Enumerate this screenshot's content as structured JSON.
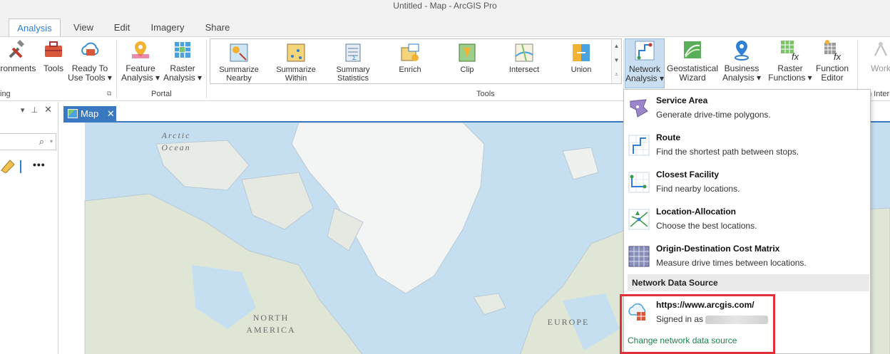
{
  "window": {
    "title": "Untitled - Map - ArcGIS Pro"
  },
  "tabs": [
    "Analysis",
    "View",
    "Edit",
    "Imagery",
    "Share"
  ],
  "ribbon": {
    "geoprocessing": {
      "environments": "ironments",
      "tools": "Tools",
      "ready_line1": "Ready To",
      "ready_line2": "Use Tools ▾",
      "group_label": "ing"
    },
    "portal": {
      "feature_line1": "Feature",
      "feature_line2": "Analysis ▾",
      "raster_line1": "Raster",
      "raster_line2": "Analysis ▾",
      "group_label": "Portal"
    },
    "tools_gallery": {
      "items": [
        {
          "line1": "Summarize",
          "line2": "Nearby",
          "icon": "summarize-nearby-icon"
        },
        {
          "line1": "Summarize",
          "line2": "Within",
          "icon": "summarize-within-icon"
        },
        {
          "line1": "Summary",
          "line2": "Statistics",
          "icon": "summary-statistics-icon"
        },
        {
          "line1": "Enrich",
          "line2": "",
          "icon": "enrich-icon"
        },
        {
          "line1": "Clip",
          "line2": "",
          "icon": "clip-icon"
        },
        {
          "line1": "Intersect",
          "line2": "",
          "icon": "intersect-icon"
        },
        {
          "line1": "Union",
          "line2": "",
          "icon": "union-icon"
        }
      ],
      "group_label": "Tools"
    },
    "workflows": [
      {
        "line1": "Network",
        "line2": "Analysis ▾",
        "icon": "network-analysis-icon"
      },
      {
        "line1": "Geostatistical",
        "line2": "Wizard",
        "icon": "geostatistical-wizard-icon"
      },
      {
        "line1": "Business",
        "line2": "Analysis ▾",
        "icon": "business-analysis-icon"
      },
      {
        "line1": "Raster",
        "line2": "Functions ▾",
        "icon": "raster-functions-icon"
      },
      {
        "line1": "Function",
        "line2": "Editor",
        "icon": "function-editor-icon"
      },
      {
        "line1": "Work",
        "line2": "",
        "icon": "workflow-icon"
      }
    ],
    "right_group_label": "n Inter"
  },
  "left_pane": {
    "more": "•••"
  },
  "map": {
    "tab_label": "Map",
    "labels": {
      "arctic_line1": "Arctic",
      "arctic_line2": "Ocean",
      "na_line1": "NORTH",
      "na_line2": "AMERICA",
      "europe": "EUROPE"
    }
  },
  "network_menu": {
    "items": [
      {
        "title": "Service Area",
        "desc": "Generate drive-time polygons."
      },
      {
        "title": "Route",
        "desc": "Find the shortest path between stops."
      },
      {
        "title": "Closest Facility",
        "desc": "Find nearby locations."
      },
      {
        "title": "Location-Allocation",
        "desc": "Choose the best locations."
      },
      {
        "title": "Origin-Destination Cost Matrix",
        "desc": "Measure drive times between locations."
      }
    ],
    "data_source_header": "Network Data Source",
    "source_url": "https://www.arcgis.com/",
    "signed_in_label": "Signed in as",
    "change_link": "Change network data source"
  },
  "colors": {
    "accent": "#2f7fd2",
    "map_tab": "#3a78c2",
    "highlight": "#e0313a",
    "link": "#1f8050",
    "ocean": "#c6dff0",
    "land": "#dfe6d6"
  }
}
